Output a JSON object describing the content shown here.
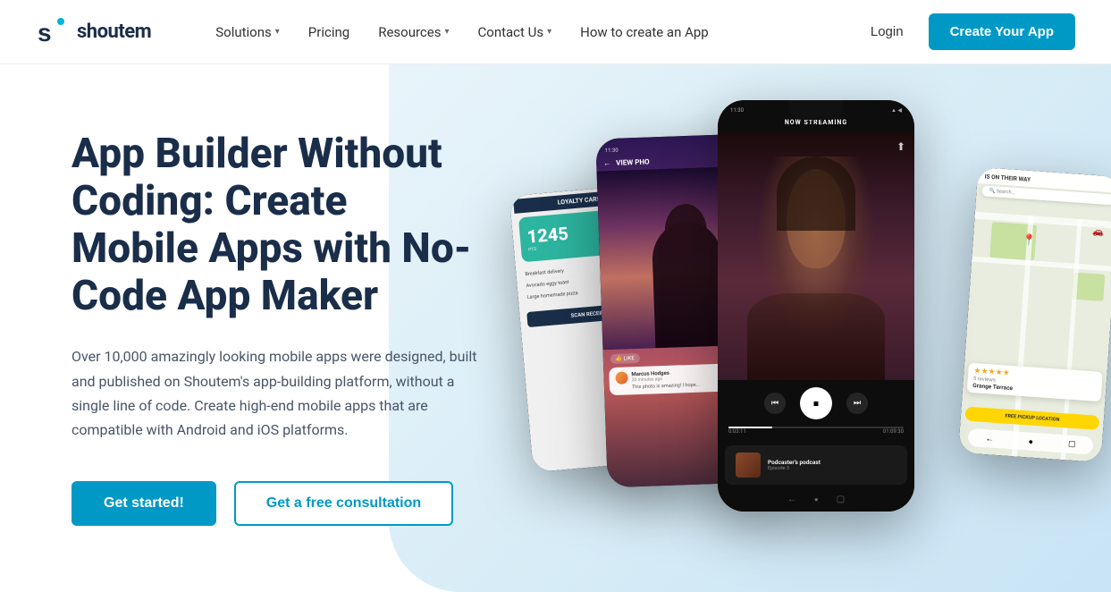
{
  "brand": {
    "name": "shoutem",
    "logo_color": "#1a2e4a",
    "accent": "#00b4d8"
  },
  "navbar": {
    "solutions_label": "Solutions",
    "pricing_label": "Pricing",
    "resources_label": "Resources",
    "contact_label": "Contact Us",
    "how_to_label": "How to create an App",
    "login_label": "Login",
    "cta_label": "Create Your App"
  },
  "hero": {
    "title": "App Builder Without Coding: Create Mobile Apps with No-Code App Maker",
    "description": "Over 10,000 amazingly looking mobile apps were designed, built and published on Shoutem's app-building platform, without a single line of code. Create high-end mobile apps that are compatible with Android and iOS platforms.",
    "btn_primary": "Get started!",
    "btn_secondary": "Get a free consultation"
  },
  "phones": {
    "left": {
      "header": "LOYALTY CARD",
      "points": "1245",
      "items": [
        "Breakfast delivery",
        "Avocado 'n' eggy toast",
        "Large homemade pizza"
      ]
    },
    "middle_portrait": {
      "header": "VIEW PHO",
      "name": "Marcus Hodges",
      "time": "20 minutes ago",
      "comment": "This photo is amazing! I hope..."
    },
    "center": {
      "status": "11:30",
      "now_streaming": "NOW STREAMING",
      "podcast_name": "Podcaster's podcast",
      "podcast_ep": "Episode 3",
      "time_start": "0:03:11",
      "time_end": "01:09:30"
    },
    "right": {
      "header": "IS ON THEIR WAY",
      "place": "Grange Terrace",
      "stars": "★★★★★",
      "rating": "5 reviews",
      "pickup_label": "FREE PICKUP LOCATION"
    }
  }
}
